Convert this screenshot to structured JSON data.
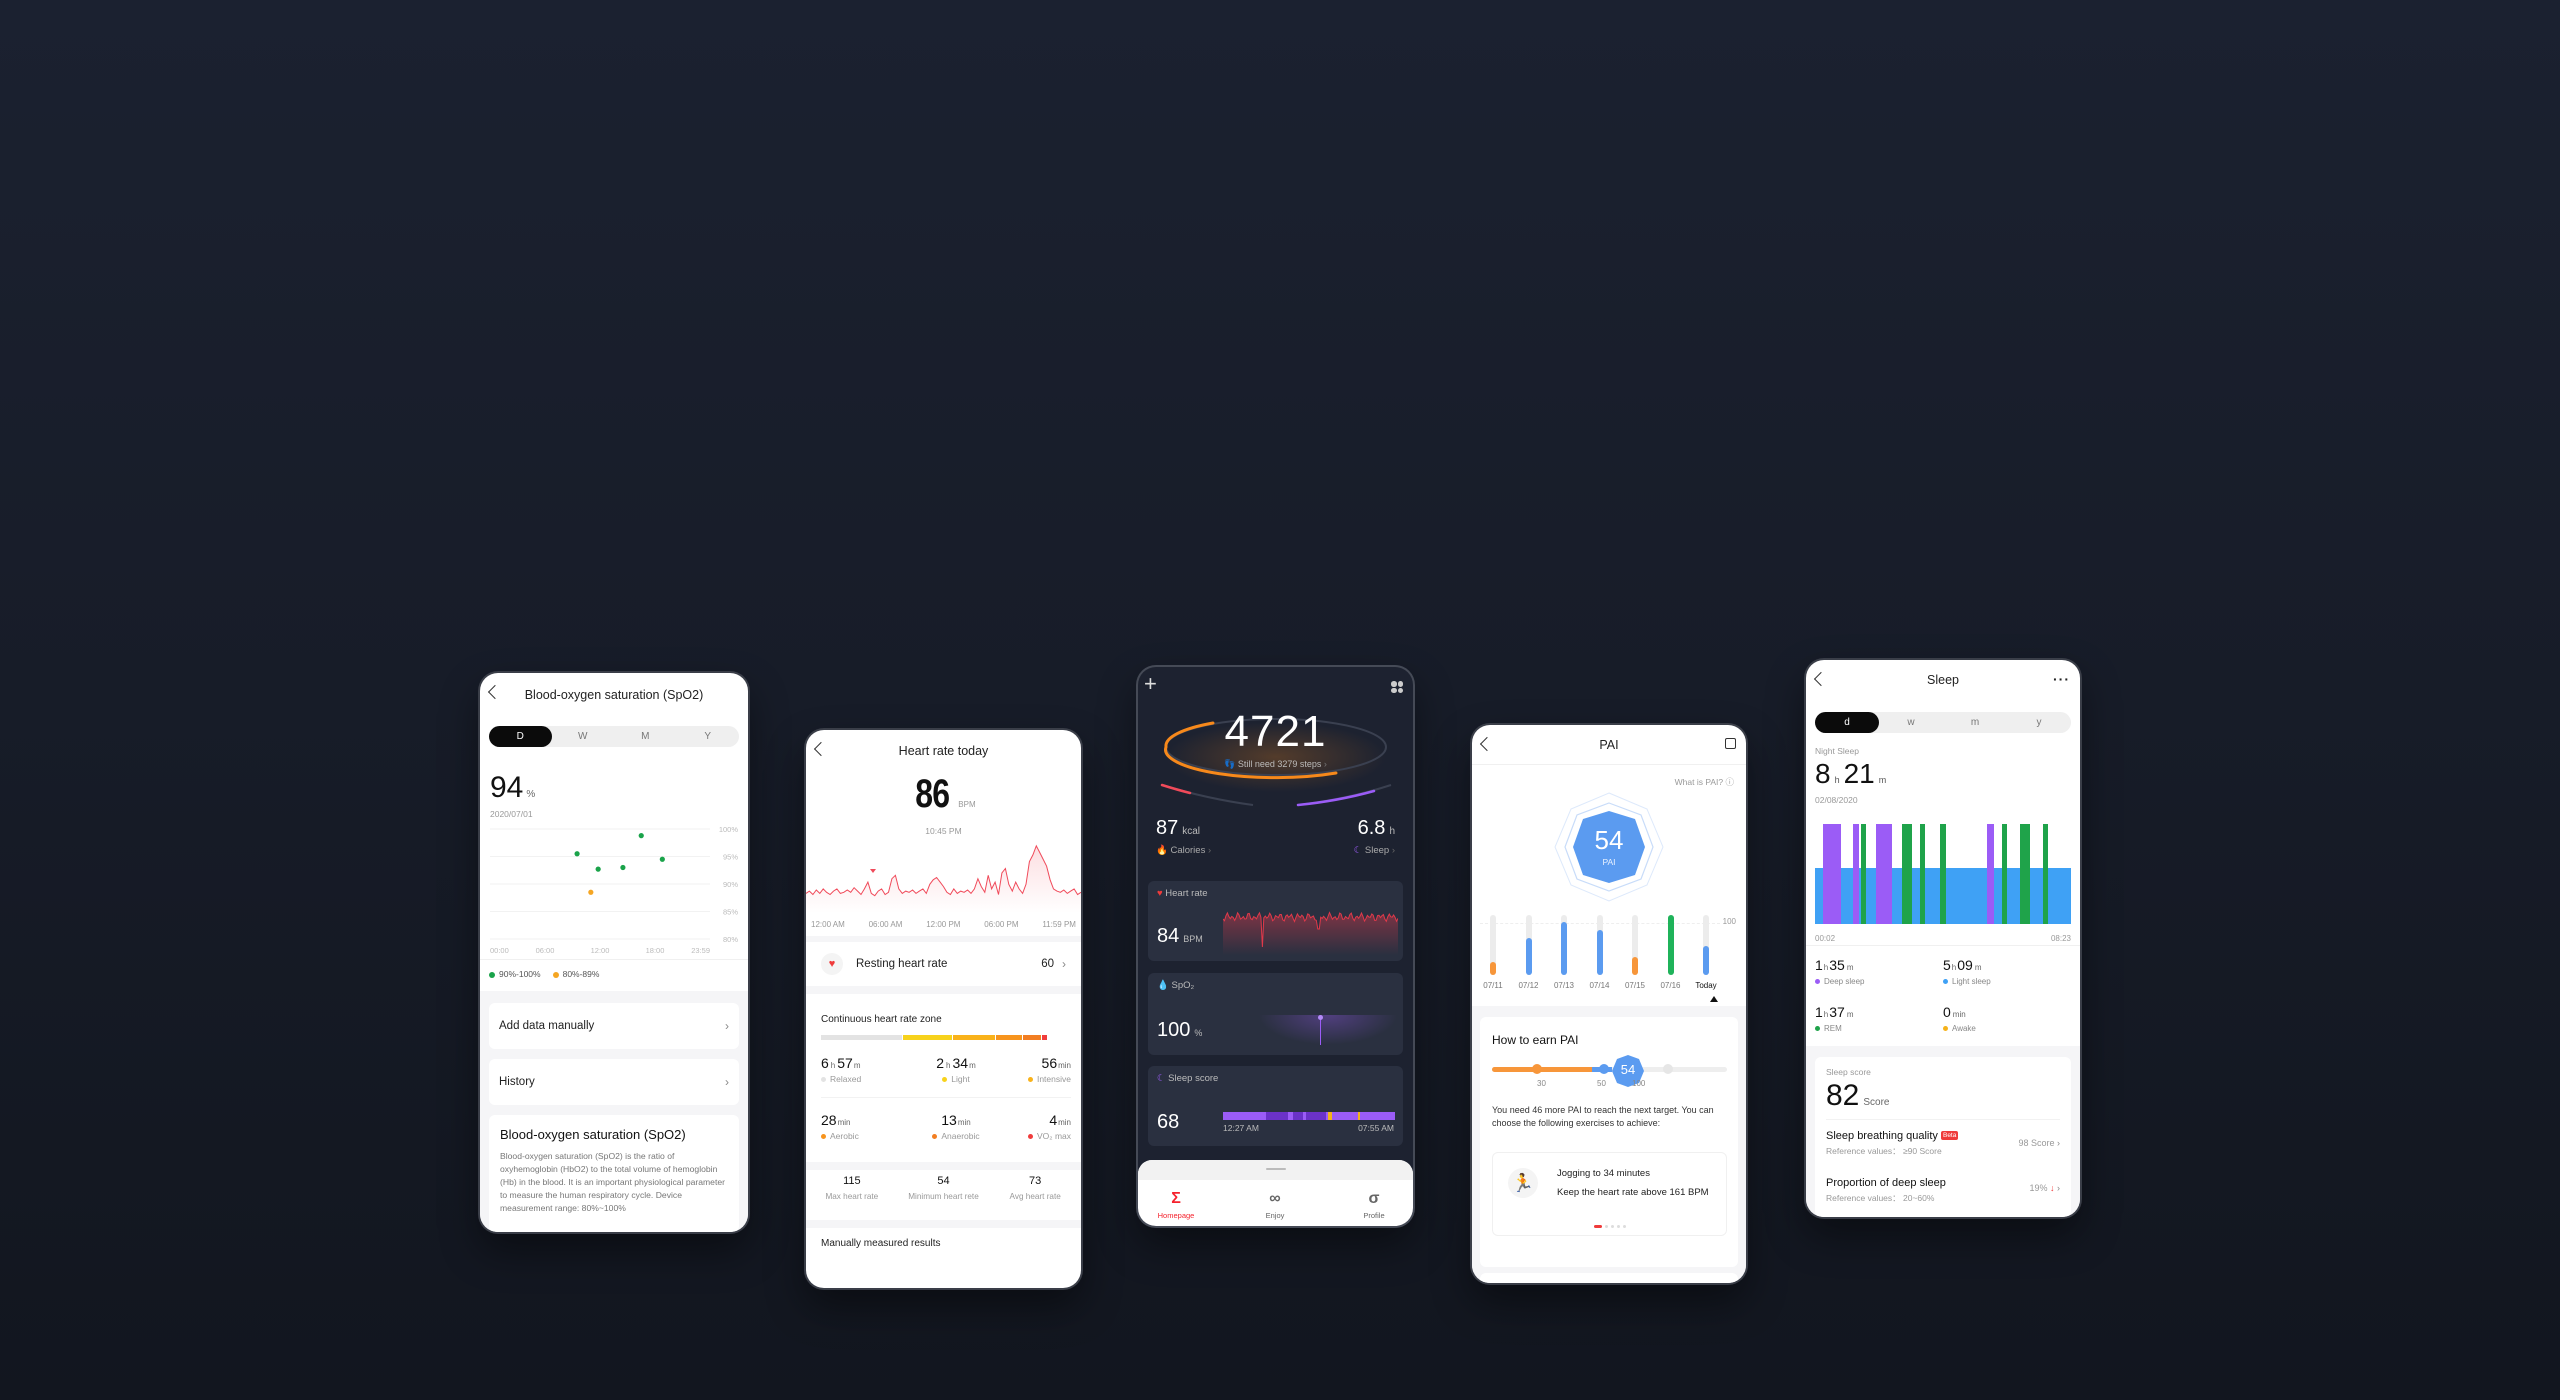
{
  "spo2": {
    "title": "Blood-oxygen saturation (SpO2)",
    "periods": [
      "D",
      "W",
      "M",
      "Y"
    ],
    "active_period": "D",
    "value": "94",
    "unit": "%",
    "date": "2020/07/01",
    "y_ticks": [
      "100%",
      "95%",
      "90%",
      "85%",
      "80%"
    ],
    "x_ticks": [
      "00:00",
      "06:00",
      "12:00",
      "18:00",
      "23:59"
    ],
    "legend": [
      {
        "label": "90%-100%",
        "color": "#1aa34a"
      },
      {
        "label": "80%-89%",
        "color": "#f5a623"
      }
    ],
    "add_data_label": "Add data manually",
    "history_label": "History",
    "info_title": "Blood-oxygen saturation (SpO2)",
    "info_text": "Blood-oxygen saturation (SpO2) is the ratio of oxyhemoglobin (HbO2) to the total volume of hemoglobin (Hb) in the blood. It is an important physiological parameter to measure the human respiratory cycle. Device measurement range: 80%~100%",
    "chart_data": {
      "type": "scatter",
      "ylim": [
        80,
        100
      ],
      "xlim": [
        0,
        24
      ],
      "points": [
        {
          "x": 9.5,
          "y": 95.5,
          "range": "90-100"
        },
        {
          "x": 11.0,
          "y": 88.5,
          "range": "80-89"
        },
        {
          "x": 11.8,
          "y": 92.7,
          "range": "90-100"
        },
        {
          "x": 14.5,
          "y": 93.0,
          "range": "90-100"
        },
        {
          "x": 16.5,
          "y": 98.8,
          "range": "90-100"
        },
        {
          "x": 18.8,
          "y": 94.5,
          "range": "90-100"
        }
      ]
    }
  },
  "heart": {
    "title": "Heart rate today",
    "value": "86",
    "unit": "BPM",
    "time": "10:45 PM",
    "x_ticks": [
      "12:00 AM",
      "06:00 AM",
      "12:00 PM",
      "06:00 PM",
      "11:59 PM"
    ],
    "resting_label": "Resting heart rate",
    "resting_value": "60",
    "zone_title": "Continuous heart rate zone",
    "zones": [
      {
        "h": "6",
        "m": "57",
        "label": "Relaxed",
        "color": "#e3e3e3",
        "share": 0.33
      },
      {
        "h": "2",
        "m": "34",
        "label": "Light",
        "color": "#f7d21c",
        "share": 0.2
      },
      {
        "min": "56",
        "label": "Intensive",
        "color": "#f9b21a",
        "share": 0.17
      },
      {
        "min": "28",
        "label": "Aerobic",
        "color": "#f7941d",
        "share": 0.11
      },
      {
        "min": "13",
        "label": "Anaerobic",
        "color": "#f27e22",
        "share": 0.07
      },
      {
        "min": "4",
        "label": "VO₂ max",
        "color": "#f03c3c",
        "share": 0.02
      }
    ],
    "h_unit": "h",
    "m_unit": "m",
    "min_unit": "min",
    "summary": [
      {
        "value": "115",
        "label": "Max heart rate"
      },
      {
        "value": "54",
        "label": "Minimum heart rete"
      },
      {
        "value": "73",
        "label": "Avg heart rate"
      }
    ],
    "manual_label": "Manually measured results",
    "chart_data": {
      "type": "line",
      "xlim": [
        0,
        24
      ],
      "series": [
        {
          "name": "Heart rate",
          "values": [
            62,
            64,
            61,
            65,
            62,
            66,
            63,
            61,
            64,
            66,
            62,
            63,
            65,
            63,
            67,
            64,
            61,
            66,
            72,
            62,
            60,
            64,
            66,
            61,
            63,
            75,
            78,
            66,
            62,
            64,
            63,
            65,
            62,
            64,
            66,
            62,
            70,
            74,
            76,
            72,
            68,
            63,
            61,
            66,
            62,
            64,
            63,
            65,
            62,
            66,
            75,
            68,
            63,
            78,
            66,
            72,
            61,
            80,
            84,
            70,
            64,
            72,
            66,
            62,
            70,
            90,
            96,
            104,
            98,
            92,
            86,
            74,
            66,
            64,
            63,
            65,
            62,
            64,
            66,
            61,
            63
          ]
        }
      ]
    }
  },
  "home": {
    "steps": "4721",
    "steps_hint": "Still need 3279 steps",
    "steps_progress": 0.59,
    "calories_value": "87",
    "calories_unit": "kcal",
    "calories_label": "Calories",
    "sleep_value": "6.8",
    "sleep_unit": "h",
    "sleep_label": "Sleep",
    "cards": {
      "heart_title": "Heart rate",
      "heart_value": "84",
      "heart_unit": "BPM",
      "spo2_title": "SpO₂",
      "spo2_value": "100",
      "spo2_unit": "%",
      "sleep_title": "Sleep score",
      "sleep_value": "68",
      "sleep_start": "12:27 AM",
      "sleep_end": "07:55 AM"
    },
    "tabs": [
      {
        "label": "Homepage",
        "icon": "sigma-icon",
        "active": true
      },
      {
        "label": "Enjoy",
        "icon": "enjoy-icon",
        "active": false
      },
      {
        "label": "Profile",
        "icon": "profile-icon",
        "active": false
      }
    ],
    "accent": "#f5222d"
  },
  "pai": {
    "title": "PAI",
    "what_is": "What is PAI?",
    "value": "54",
    "label": "PAI",
    "bars_max_label": "100",
    "chart_data": {
      "type": "bar",
      "categories": [
        "07/11",
        "07/12",
        "07/13",
        "07/14",
        "07/15",
        "07/16",
        "Today"
      ],
      "values": [
        22,
        62,
        88,
        75,
        30,
        100,
        48
      ],
      "colors": [
        "#f7963a",
        "#5b9bf0",
        "#5b9bf0",
        "#5b9bf0",
        "#f7963a",
        "#1fb35a",
        "#5b9bf0"
      ],
      "ylim": [
        0,
        100
      ]
    },
    "earn_title": "How to earn PAI",
    "slider_ticks": [
      "30",
      "50",
      "100"
    ],
    "slider_value": 54,
    "need_text": "You need 46 more PAI to reach the next target. You can choose the following exercises to achieve:",
    "exercise_title": "Jogging to 34 minutes",
    "exercise_desc": "Keep the heart rate above 161 BPM",
    "carousel_pages": 5,
    "carousel_active": 0
  },
  "sleep": {
    "title": "Sleep",
    "periods": [
      "d",
      "w",
      "m",
      "y"
    ],
    "active_period": "d",
    "night_label": "Night Sleep",
    "hours": "8",
    "minutes": "21",
    "date": "02/08/2020",
    "start": "00:02",
    "end": "08:23",
    "stats": [
      {
        "h": "1",
        "m": "35",
        "label": "Deep sleep",
        "color": "#9b5cf6"
      },
      {
        "h": "5",
        "m": "09",
        "label": "Light sleep",
        "color": "#3fa1f5"
      },
      {
        "h": "1",
        "m": "37",
        "label": "REM",
        "color": "#1fa34a"
      },
      {
        "min": "0",
        "label": "Awake",
        "color": "#f5b21a"
      }
    ],
    "score_label": "Sleep score",
    "score": "82",
    "score_unit": "Score",
    "breathing_label": "Sleep breathing quality",
    "beta": "Beta",
    "breathing_ref": "Reference values： ≥90 Score",
    "breathing_value": "98 Score",
    "deep_label": "Proportion of deep sleep",
    "deep_ref": "Reference values： 20~60%",
    "deep_value": "19%",
    "chart_data": {
      "type": "bar",
      "xlim": [
        "00:02",
        "08:23"
      ],
      "segments": [
        {
          "stage": "deep",
          "start": 0.03,
          "end": 0.1
        },
        {
          "stage": "deep",
          "start": 0.15,
          "end": 0.17
        },
        {
          "stage": "rem",
          "start": 0.18,
          "end": 0.2
        },
        {
          "stage": "deep",
          "start": 0.24,
          "end": 0.3
        },
        {
          "stage": "rem",
          "start": 0.34,
          "end": 0.38
        },
        {
          "stage": "rem",
          "start": 0.41,
          "end": 0.43
        },
        {
          "stage": "rem",
          "start": 0.49,
          "end": 0.51
        },
        {
          "stage": "deep",
          "start": 0.67,
          "end": 0.7
        },
        {
          "stage": "rem",
          "start": 0.73,
          "end": 0.75
        },
        {
          "stage": "rem",
          "start": 0.8,
          "end": 0.84
        },
        {
          "stage": "rem",
          "start": 0.89,
          "end": 0.91
        }
      ]
    }
  }
}
